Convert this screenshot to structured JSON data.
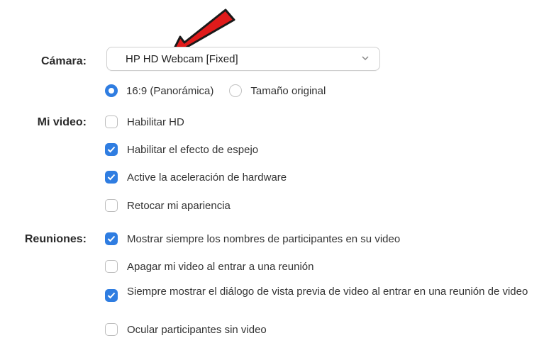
{
  "settings": {
    "camera_label": "Cámara:",
    "camera_value": "HP HD Webcam [Fixed]",
    "aspect_options": [
      {
        "label": "16:9 (Panorámica)",
        "selected": true
      },
      {
        "label": "Tamaño original",
        "selected": false
      }
    ],
    "my_video_label": "Mi video:",
    "video_options": [
      {
        "label": "Habilitar HD",
        "checked": false
      },
      {
        "label": "Habilitar el efecto de espejo",
        "checked": true
      },
      {
        "label": "Active la aceleración de hardware",
        "checked": true
      },
      {
        "label": "Retocar mi apariencia",
        "checked": false
      }
    ],
    "meetings_label": "Reuniones:",
    "meeting_options": [
      {
        "label": "Mostrar siempre los nombres de participantes en su video",
        "checked": true
      },
      {
        "label": "Apagar mi video al entrar a una reunión",
        "checked": false
      },
      {
        "label": "Siempre mostrar el diálogo de vista previa de video al entrar en una reunión de video",
        "checked": true
      },
      {
        "label": "Ocular participantes sin video",
        "checked": false
      }
    ]
  },
  "colors": {
    "accent": "#2f7de1",
    "annotation_arrow": "#e01b1b"
  },
  "icons": {
    "dropdown": "chevron-down-icon",
    "checked": "checkmark-icon",
    "annotation": "red-arrow-icon"
  }
}
